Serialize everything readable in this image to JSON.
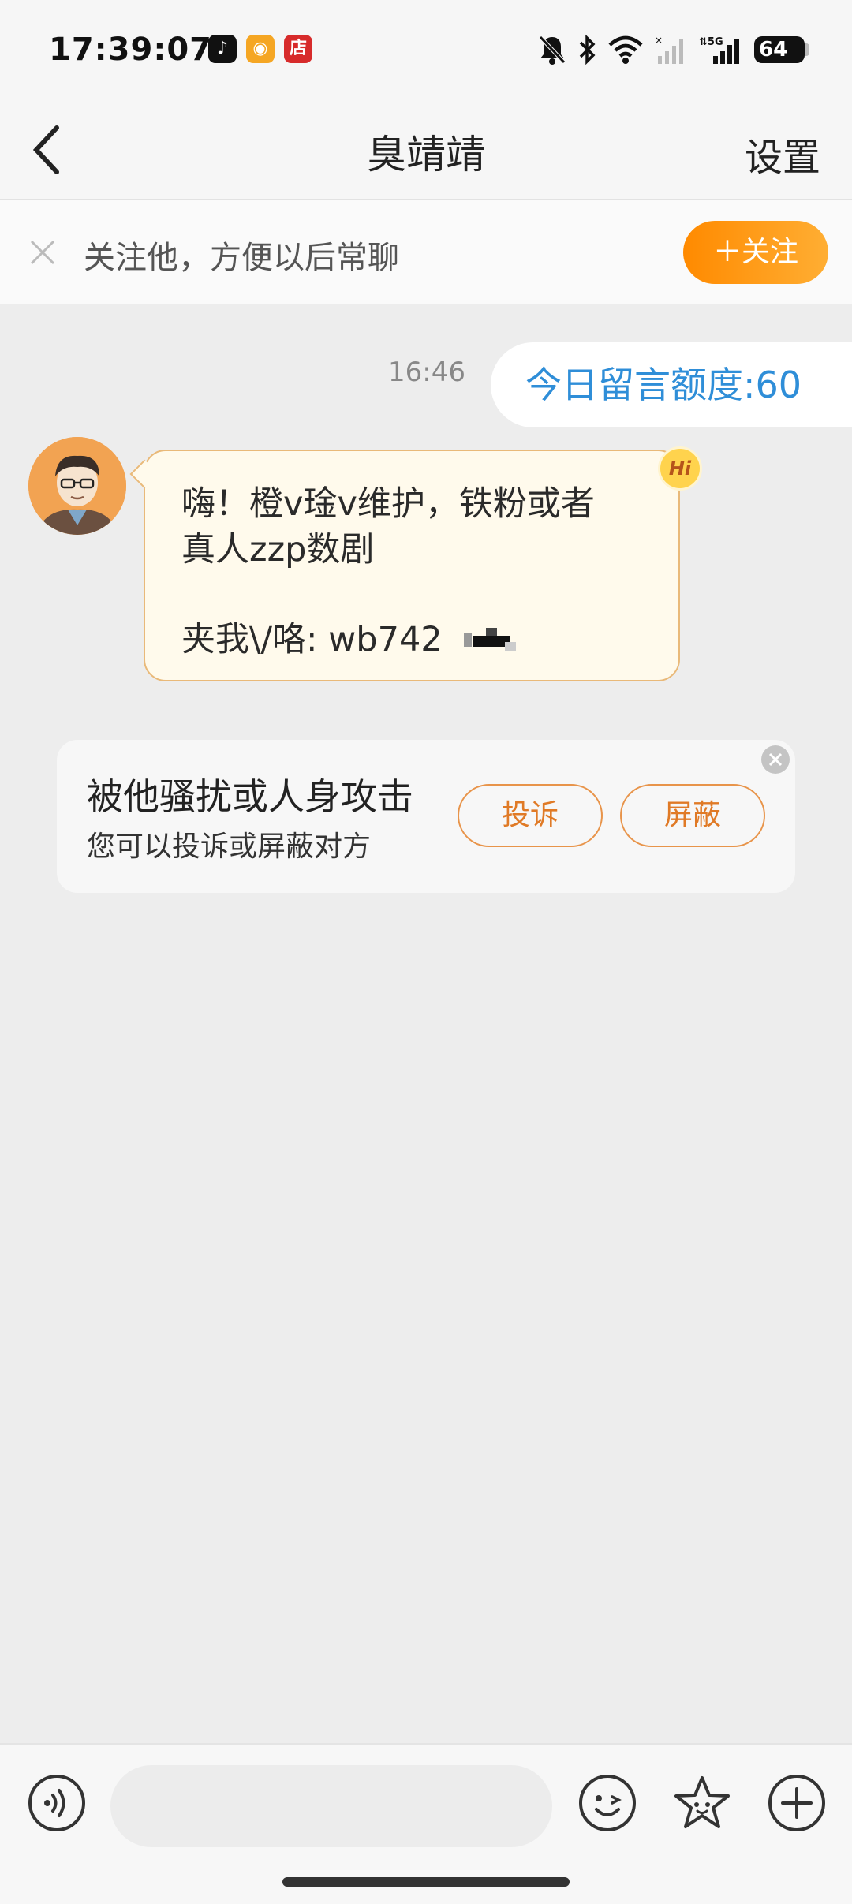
{
  "status_bar": {
    "time": "17:39:07",
    "app_icons": [
      {
        "name": "douyin-icon",
        "glyph": "♪",
        "color": "#111111"
      },
      {
        "name": "weibo-icon",
        "glyph": "◉",
        "color": "#f5a623"
      },
      {
        "name": "shop-icon",
        "glyph": "店",
        "color": "#d72b2b"
      }
    ],
    "network": "5G",
    "battery": "64"
  },
  "nav": {
    "title": "臭靖靖",
    "settings_label": "设置"
  },
  "follow_banner": {
    "text": "关注他，方便以后常聊",
    "button_label": "＋关注"
  },
  "messages": {
    "time": "16:46",
    "quota_text": "今日留言额度:60",
    "incoming": {
      "line1": "嗨！橙v琻v维护，铁粉或者",
      "line2": "真人zzp数剧",
      "line3": "夹我\\/咯: wb742",
      "badge": "Hi"
    }
  },
  "harassment_card": {
    "title": "被他骚扰或人身攻击",
    "subtitle": "您可以投诉或屏蔽对方",
    "report_label": "投诉",
    "block_label": "屏蔽"
  },
  "input_bar": {
    "placeholder": "",
    "icons": [
      "voice-icon",
      "emoji-icon",
      "sticker-icon",
      "plus-icon"
    ]
  },
  "colors": {
    "accent": "#ff8a00",
    "quota_text": "#2f8ed8",
    "bubble_border": "#e9b979"
  }
}
